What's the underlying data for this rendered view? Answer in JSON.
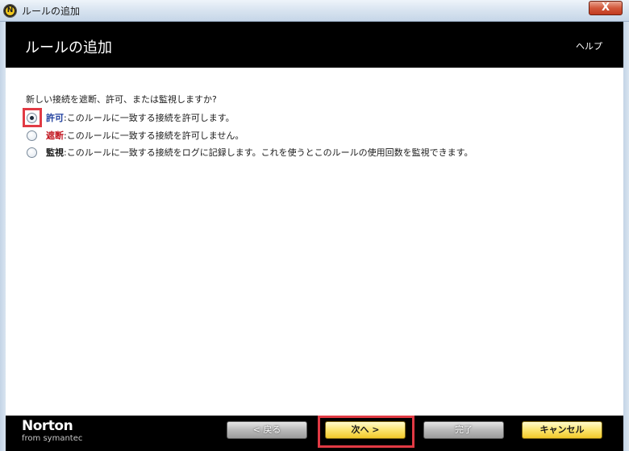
{
  "window": {
    "title": "ルールの追加",
    "icon": "norton-shield-icon",
    "close_symbol": "X"
  },
  "header": {
    "title": "ルールの追加",
    "help_label": "ヘルプ"
  },
  "main": {
    "question": "新しい接続を遮断、許可、または監視しますか?",
    "options": [
      {
        "key": "許可",
        "text": ":このルールに一致する接続を許可します。",
        "selected": true
      },
      {
        "key": "遮断",
        "text": ":このルールに一致する接続を許可しません。",
        "selected": false
      },
      {
        "key": "監視",
        "text": ":このルールに一致する接続をログに記録します。これを使うとこのルールの使用回数を監視できます。",
        "selected": false
      }
    ]
  },
  "footer": {
    "logo_main": "Norton",
    "logo_sub": "from symantec",
    "back_label": "< 戻る",
    "next_label": "次へ >",
    "finish_label": "完了",
    "cancel_label": "キャンセル"
  },
  "colors": {
    "header_bg": "#000000",
    "allow_key": "#1f3f9e",
    "block_key": "#c0101a",
    "highlight": "#e13a44",
    "primary_button": "#fbe46e"
  }
}
